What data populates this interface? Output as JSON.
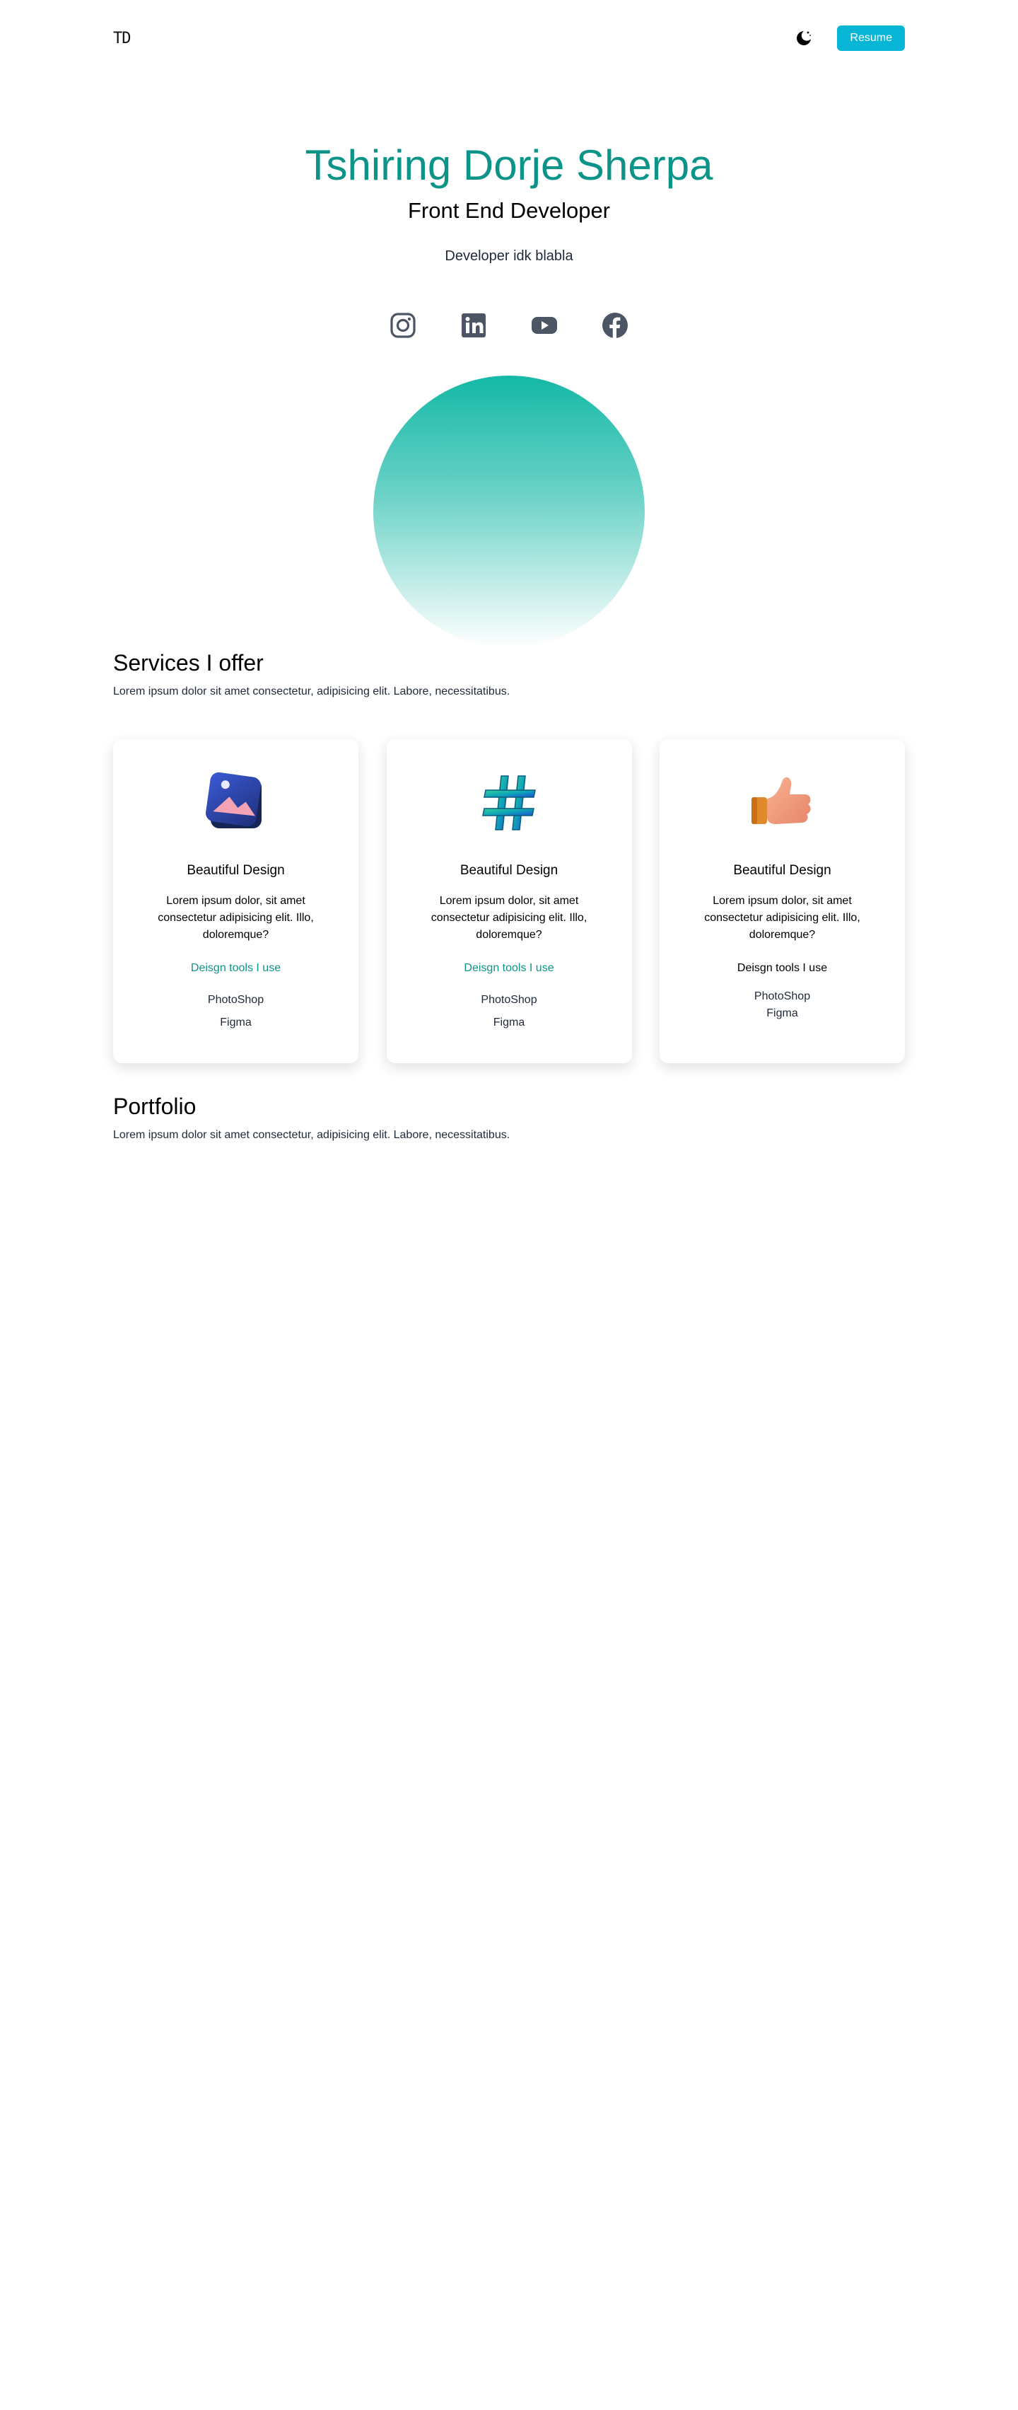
{
  "nav": {
    "logo": "TD",
    "theme_icon": "moon-icon",
    "resume_label": "Resume",
    "accent": "#06b6d4"
  },
  "hero": {
    "name": "Tshiring Dorje Sherpa",
    "role": "Front End Developer",
    "tagline": "Developer idk blabla",
    "name_color": "#0d9488"
  },
  "socials": [
    {
      "icon": "instagram-icon"
    },
    {
      "icon": "linkedin-icon"
    },
    {
      "icon": "youtube-icon"
    },
    {
      "icon": "facebook-icon"
    }
  ],
  "services": {
    "title": "Services I offer",
    "description": "Lorem ipsum dolor sit amet consectetur, adipisicing elit. Labore, necessitatibus.",
    "cards": [
      {
        "icon": "image-design-icon",
        "title": "Beautiful Design",
        "text": "Lorem ipsum dolor, sit amet consectetur adipisicing elit. Illo, doloremque?",
        "tools_title": "Deisgn tools I use",
        "tools": [
          "PhotoShop",
          "Figma"
        ]
      },
      {
        "icon": "hashtag-icon",
        "title": "Beautiful Design",
        "text": "Lorem ipsum dolor, sit amet consectetur adipisicing elit. Illo, doloremque?",
        "tools_title": "Deisgn tools I use",
        "tools": [
          "PhotoShop",
          "Figma"
        ]
      },
      {
        "icon": "thumbs-up-icon",
        "title": "Beautiful Design",
        "text": "Lorem ipsum dolor, sit amet consectetur adipisicing elit. Illo, doloremque?",
        "tools_title": "Deisgn tools I use",
        "tools": [
          "PhotoShop",
          "Figma"
        ]
      }
    ]
  },
  "portfolio": {
    "title": "Portfolio",
    "description": "Lorem ipsum dolor sit amet consectetur, adipisicing elit. Labore, necessitatibus."
  }
}
